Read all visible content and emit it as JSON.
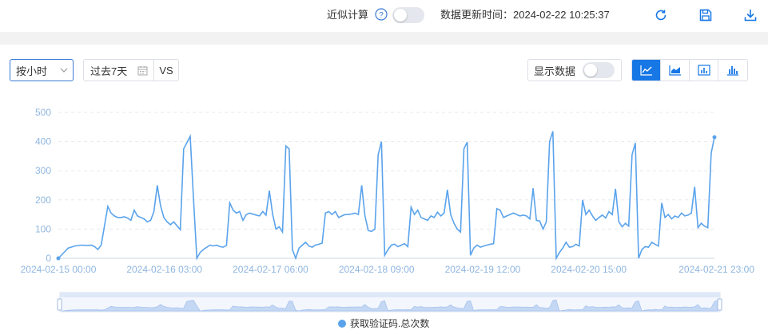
{
  "toolbar": {
    "approx_label": "近似计算",
    "update_label": "数据更新时间：2024-02-22 10:25:37",
    "approx_on": false
  },
  "filters": {
    "granularity": "按小时",
    "range": "过去7天",
    "compare": "VS",
    "show_data_label": "显示数据",
    "show_data_on": false,
    "chart_types": [
      "line-chart-icon",
      "area-chart-icon",
      "bar-chart-icon",
      "column-chart-icon"
    ],
    "active_type": "line-chart-icon"
  },
  "colors": {
    "accent": "#1677e5",
    "series": "#5aa3ec",
    "axis_text": "#8fb6e0"
  },
  "chart_data": {
    "type": "line",
    "xlabel": "",
    "ylabel": "",
    "ylim": [
      0,
      500
    ],
    "yticks": [
      0,
      100,
      200,
      300,
      400,
      500
    ],
    "xticks": [
      "2024-02-15 00:00",
      "2024-02-16 03:00",
      "2024-02-17 06:00",
      "2024-02-18 09:00",
      "2024-02-19 12:00",
      "2024-02-20 15:00",
      "2024-02-21 23:00"
    ],
    "x_start": "2024-02-15 00:00",
    "x_end": "2024-02-21 23:00",
    "series": [
      {
        "name": "获取验证码.总次数",
        "values": [
          [
            0,
            0
          ],
          [
            3,
            35
          ],
          [
            5,
            42
          ],
          [
            7,
            45
          ],
          [
            9,
            44
          ],
          [
            10,
            45
          ],
          [
            11,
            40
          ],
          [
            12,
            30
          ],
          [
            13,
            45
          ],
          [
            15,
            178
          ],
          [
            16,
            155
          ],
          [
            17,
            145
          ],
          [
            18,
            140
          ],
          [
            19,
            140
          ],
          [
            20,
            142
          ],
          [
            21,
            138
          ],
          [
            22,
            130
          ],
          [
            23,
            165
          ],
          [
            24,
            145
          ],
          [
            25,
            140
          ],
          [
            26,
            135
          ],
          [
            27,
            125
          ],
          [
            28,
            130
          ],
          [
            29,
            160
          ],
          [
            30,
            250
          ],
          [
            31,
            180
          ],
          [
            32,
            140
          ],
          [
            33,
            125
          ],
          [
            34,
            115
          ],
          [
            35,
            125
          ],
          [
            37,
            98
          ],
          [
            38,
            375
          ],
          [
            40,
            418
          ],
          [
            41,
            200
          ],
          [
            42,
            0
          ],
          [
            43,
            20
          ],
          [
            44,
            30
          ],
          [
            46,
            45
          ],
          [
            47,
            42
          ],
          [
            48,
            45
          ],
          [
            49,
            40
          ],
          [
            50,
            38
          ],
          [
            51,
            44
          ],
          [
            52,
            190
          ],
          [
            53,
            165
          ],
          [
            54,
            155
          ],
          [
            55,
            160
          ],
          [
            56,
            130
          ],
          [
            57,
            150
          ],
          [
            58,
            155
          ],
          [
            60,
            148
          ],
          [
            61,
            145
          ],
          [
            62,
            160
          ],
          [
            63,
            148
          ],
          [
            64,
            232
          ],
          [
            65,
            150
          ],
          [
            66,
            100
          ],
          [
            67,
            108
          ],
          [
            68,
            90
          ],
          [
            69,
            385
          ],
          [
            70,
            375
          ],
          [
            71,
            30
          ],
          [
            72,
            0
          ],
          [
            73,
            35
          ],
          [
            74,
            45
          ],
          [
            75,
            55
          ],
          [
            76,
            42
          ],
          [
            77,
            38
          ],
          [
            78,
            45
          ],
          [
            79,
            48
          ],
          [
            80,
            52
          ],
          [
            81,
            155
          ],
          [
            82,
            160
          ],
          [
            83,
            150
          ],
          [
            84,
            160
          ],
          [
            85,
            140
          ],
          [
            86,
            145
          ],
          [
            87,
            150
          ],
          [
            88,
            150
          ],
          [
            89,
            152
          ],
          [
            90,
            155
          ],
          [
            91,
            150
          ],
          [
            92,
            250
          ],
          [
            93,
            145
          ],
          [
            94,
            95
          ],
          [
            95,
            92
          ],
          [
            96,
            100
          ],
          [
            97,
            355
          ],
          [
            98,
            400
          ],
          [
            99,
            10
          ],
          [
            100,
            30
          ],
          [
            101,
            45
          ],
          [
            102,
            48
          ],
          [
            103,
            40
          ],
          [
            104,
            45
          ],
          [
            105,
            50
          ],
          [
            106,
            40
          ],
          [
            107,
            175
          ],
          [
            108,
            150
          ],
          [
            109,
            165
          ],
          [
            110,
            140
          ],
          [
            111,
            135
          ],
          [
            112,
            130
          ],
          [
            113,
            145
          ],
          [
            114,
            140
          ],
          [
            115,
            158
          ],
          [
            116,
            145
          ],
          [
            117,
            155
          ],
          [
            118,
            235
          ],
          [
            119,
            150
          ],
          [
            120,
            120
          ],
          [
            121,
            100
          ],
          [
            122,
            90
          ],
          [
            123,
            375
          ],
          [
            124,
            398
          ],
          [
            125,
            10
          ],
          [
            126,
            35
          ],
          [
            127,
            45
          ],
          [
            128,
            38
          ],
          [
            129,
            42
          ],
          [
            130,
            45
          ],
          [
            131,
            48
          ],
          [
            132,
            50
          ],
          [
            133,
            170
          ],
          [
            134,
            165
          ],
          [
            135,
            140
          ],
          [
            136,
            145
          ],
          [
            137,
            150
          ],
          [
            138,
            155
          ],
          [
            139,
            150
          ],
          [
            140,
            145
          ],
          [
            141,
            148
          ],
          [
            142,
            145
          ],
          [
            143,
            135
          ],
          [
            144,
            240
          ],
          [
            145,
            130
          ],
          [
            146,
            128
          ],
          [
            147,
            100
          ],
          [
            148,
            125
          ],
          [
            149,
            400
          ],
          [
            150,
            435
          ],
          [
            151,
            0
          ],
          [
            152,
            20
          ],
          [
            153,
            35
          ],
          [
            154,
            55
          ],
          [
            155,
            38
          ],
          [
            156,
            40
          ],
          [
            157,
            48
          ],
          [
            158,
            42
          ],
          [
            159,
            200
          ],
          [
            160,
            150
          ],
          [
            161,
            165
          ],
          [
            162,
            145
          ],
          [
            163,
            130
          ],
          [
            164,
            140
          ],
          [
            165,
            148
          ],
          [
            166,
            138
          ],
          [
            167,
            160
          ],
          [
            168,
            150
          ],
          [
            169,
            238
          ],
          [
            170,
            125
          ],
          [
            171,
            108
          ],
          [
            172,
            120
          ],
          [
            173,
            110
          ],
          [
            174,
            355
          ],
          [
            175,
            395
          ],
          [
            176,
            0
          ],
          [
            177,
            30
          ],
          [
            178,
            40
          ],
          [
            179,
            38
          ],
          [
            180,
            55
          ],
          [
            181,
            48
          ],
          [
            182,
            42
          ],
          [
            183,
            190
          ],
          [
            184,
            140
          ],
          [
            185,
            150
          ],
          [
            186,
            135
          ],
          [
            187,
            145
          ],
          [
            188,
            140
          ],
          [
            189,
            155
          ],
          [
            190,
            145
          ],
          [
            191,
            148
          ],
          [
            192,
            155
          ],
          [
            193,
            245
          ],
          [
            194,
            105
          ],
          [
            195,
            120
          ],
          [
            196,
            110
          ],
          [
            197,
            105
          ],
          [
            198,
            360
          ],
          [
            199,
            415
          ]
        ]
      }
    ]
  }
}
